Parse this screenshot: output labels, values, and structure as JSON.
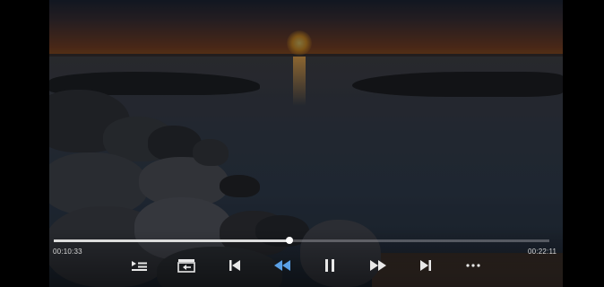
{
  "player": {
    "elapsed_time": "00:10:33",
    "total_time": "00:22:11",
    "progress_fraction": 0.475,
    "accent_color": "#5aa0e6",
    "icon_color": "#e8e8e8"
  },
  "controls": [
    {
      "icon": "playlist-icon"
    },
    {
      "icon": "exit-popup-icon"
    },
    {
      "icon": "previous-track-icon"
    },
    {
      "icon": "rewind-icon"
    },
    {
      "icon": "pause-icon"
    },
    {
      "icon": "fast-forward-icon"
    },
    {
      "icon": "next-track-icon"
    },
    {
      "icon": "more-options-icon"
    }
  ]
}
